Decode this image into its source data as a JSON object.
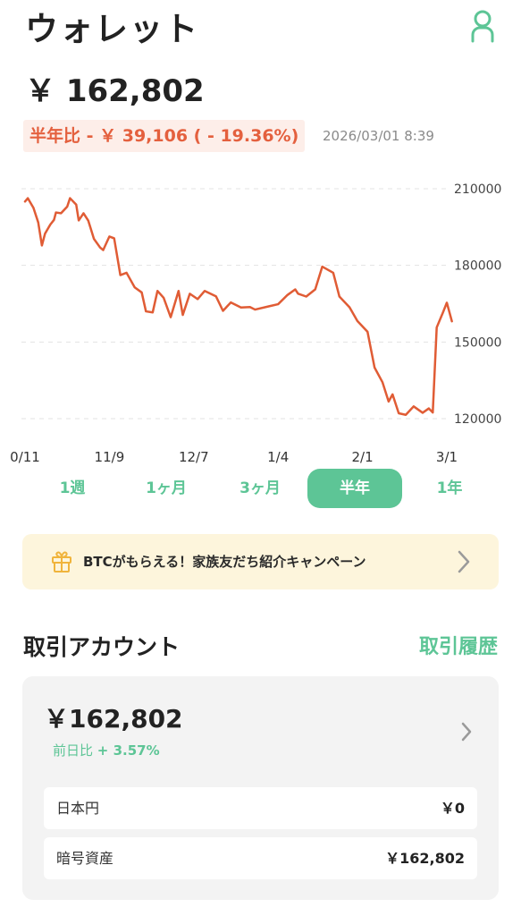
{
  "header": {
    "title": "ウォレット",
    "profile_icon": "user-icon",
    "accent_color": "#5dc596"
  },
  "balance": "￥ 162,802",
  "change": {
    "text": "半年比 - ￥ 39,106 ( - 19.36%)",
    "timestamp": "2026/03/01 8:39",
    "color": "#e4603e"
  },
  "chart_data": {
    "type": "line",
    "x_ticks": [
      "0/11",
      "11/9",
      "12/7",
      "1/4",
      "2/1",
      "3/1"
    ],
    "y_ticks": [
      "210000",
      "180000",
      "150000",
      "120000"
    ],
    "ylim": [
      120000,
      210000
    ],
    "grid": true,
    "series": [
      {
        "color": "#e05c35",
        "values": [
          [
            0.0,
            205000
          ],
          [
            0.1,
            206300
          ],
          [
            0.3,
            202500
          ],
          [
            0.47,
            196800
          ],
          [
            0.6,
            187800
          ],
          [
            0.71,
            192400
          ],
          [
            0.9,
            196000
          ],
          [
            1.03,
            197800
          ],
          [
            1.1,
            200700
          ],
          [
            1.28,
            200400
          ],
          [
            1.5,
            203000
          ],
          [
            1.6,
            206300
          ],
          [
            1.82,
            203800
          ],
          [
            1.91,
            197600
          ],
          [
            2.08,
            200400
          ],
          [
            2.25,
            197500
          ],
          [
            2.45,
            190400
          ],
          [
            2.67,
            187000
          ],
          [
            2.78,
            186000
          ],
          [
            3.0,
            191300
          ],
          [
            3.17,
            190600
          ],
          [
            3.39,
            176200
          ],
          [
            3.61,
            177100
          ],
          [
            3.9,
            171400
          ],
          [
            4.15,
            169400
          ],
          [
            4.3,
            162000
          ],
          [
            4.54,
            161600
          ],
          [
            4.71,
            170000
          ],
          [
            4.93,
            167300
          ],
          [
            5.18,
            159700
          ],
          [
            5.46,
            170000
          ],
          [
            5.61,
            160600
          ],
          [
            5.86,
            168900
          ],
          [
            6.14,
            166800
          ],
          [
            6.39,
            170000
          ],
          [
            6.79,
            167900
          ],
          [
            7.04,
            162200
          ],
          [
            7.32,
            165500
          ],
          [
            7.68,
            163500
          ],
          [
            8.0,
            163700
          ],
          [
            8.18,
            162700
          ],
          [
            8.68,
            164000
          ],
          [
            9.0,
            164800
          ],
          [
            9.32,
            168300
          ],
          [
            9.61,
            170600
          ],
          [
            9.71,
            168900
          ],
          [
            10.0,
            167800
          ],
          [
            10.32,
            170600
          ],
          [
            10.57,
            179500
          ],
          [
            10.96,
            177100
          ],
          [
            11.18,
            167800
          ],
          [
            11.54,
            163600
          ],
          [
            11.82,
            158200
          ],
          [
            12.18,
            154000
          ],
          [
            12.43,
            140000
          ],
          [
            12.71,
            134300
          ],
          [
            12.93,
            126700
          ],
          [
            13.07,
            129500
          ],
          [
            13.29,
            122100
          ],
          [
            13.54,
            121500
          ],
          [
            13.82,
            124800
          ],
          [
            14.14,
            122300
          ],
          [
            14.36,
            124000
          ],
          [
            14.5,
            122400
          ],
          [
            14.64,
            155700
          ],
          [
            14.86,
            161500
          ],
          [
            15.0,
            165400
          ],
          [
            15.18,
            158100
          ]
        ]
      }
    ]
  },
  "range_tabs": [
    {
      "label": "1週",
      "active": false
    },
    {
      "label": "1ヶ月",
      "active": false
    },
    {
      "label": "3ヶ月",
      "active": false
    },
    {
      "label": "半年",
      "active": true
    },
    {
      "label": "1年",
      "active": false
    }
  ],
  "campaign": {
    "text": "BTCがもらえる！家族友だち紹介キャンペーン",
    "icon": "gift-icon",
    "chevron": "chevron-right-icon",
    "background": "#fdf5dc"
  },
  "accounts": {
    "title": "取引アカウント",
    "history_link": "取引履歴",
    "card": {
      "balance": "￥162,802",
      "change_label": "前日比",
      "change_value": "+ 3.57%",
      "assets": [
        {
          "name": "日本円",
          "amount": "￥0"
        },
        {
          "name": "暗号資産",
          "amount": "￥162,802"
        }
      ]
    }
  }
}
